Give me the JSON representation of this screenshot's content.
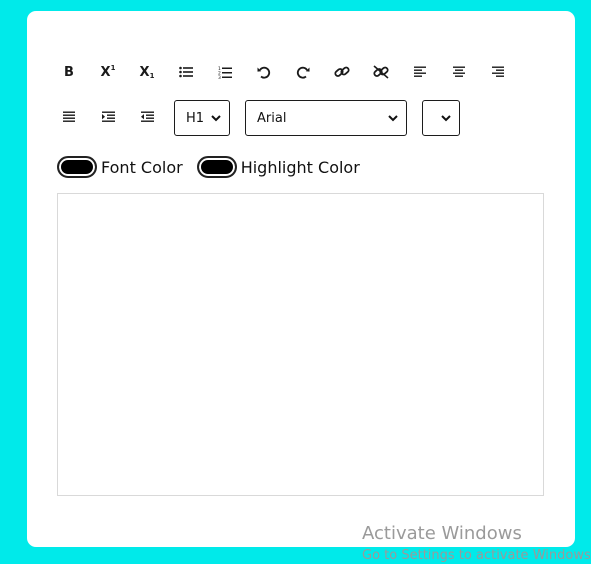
{
  "toolbar": {
    "bold_label": "B",
    "superscript_label": "X",
    "superscript_mark": "1",
    "subscript_label": "X",
    "subscript_mark": "1",
    "heading_select": {
      "value": "H1"
    },
    "font_select": {
      "value": "Arial"
    },
    "size_select": {
      "value": ""
    }
  },
  "colors": {
    "font_color_label": "Font Color",
    "highlight_color_label": "Highlight Color",
    "font_color_value": "#000000",
    "highlight_color_value": "#000000"
  },
  "watermark": {
    "title": "Activate Windows",
    "subtitle": "Go to Settings to activate Windows."
  },
  "theme": {
    "background": "#00eaea",
    "card": "#ffffff"
  },
  "icons": [
    "bold-icon",
    "superscript-icon",
    "subscript-icon",
    "bullet-list-icon",
    "numbered-list-icon",
    "undo-icon",
    "redo-icon",
    "link-icon",
    "unlink-icon",
    "align-left-icon",
    "align-center-icon",
    "align-right-icon",
    "justify-icon",
    "indent-icon",
    "outdent-icon",
    "chevron-down-icon"
  ]
}
